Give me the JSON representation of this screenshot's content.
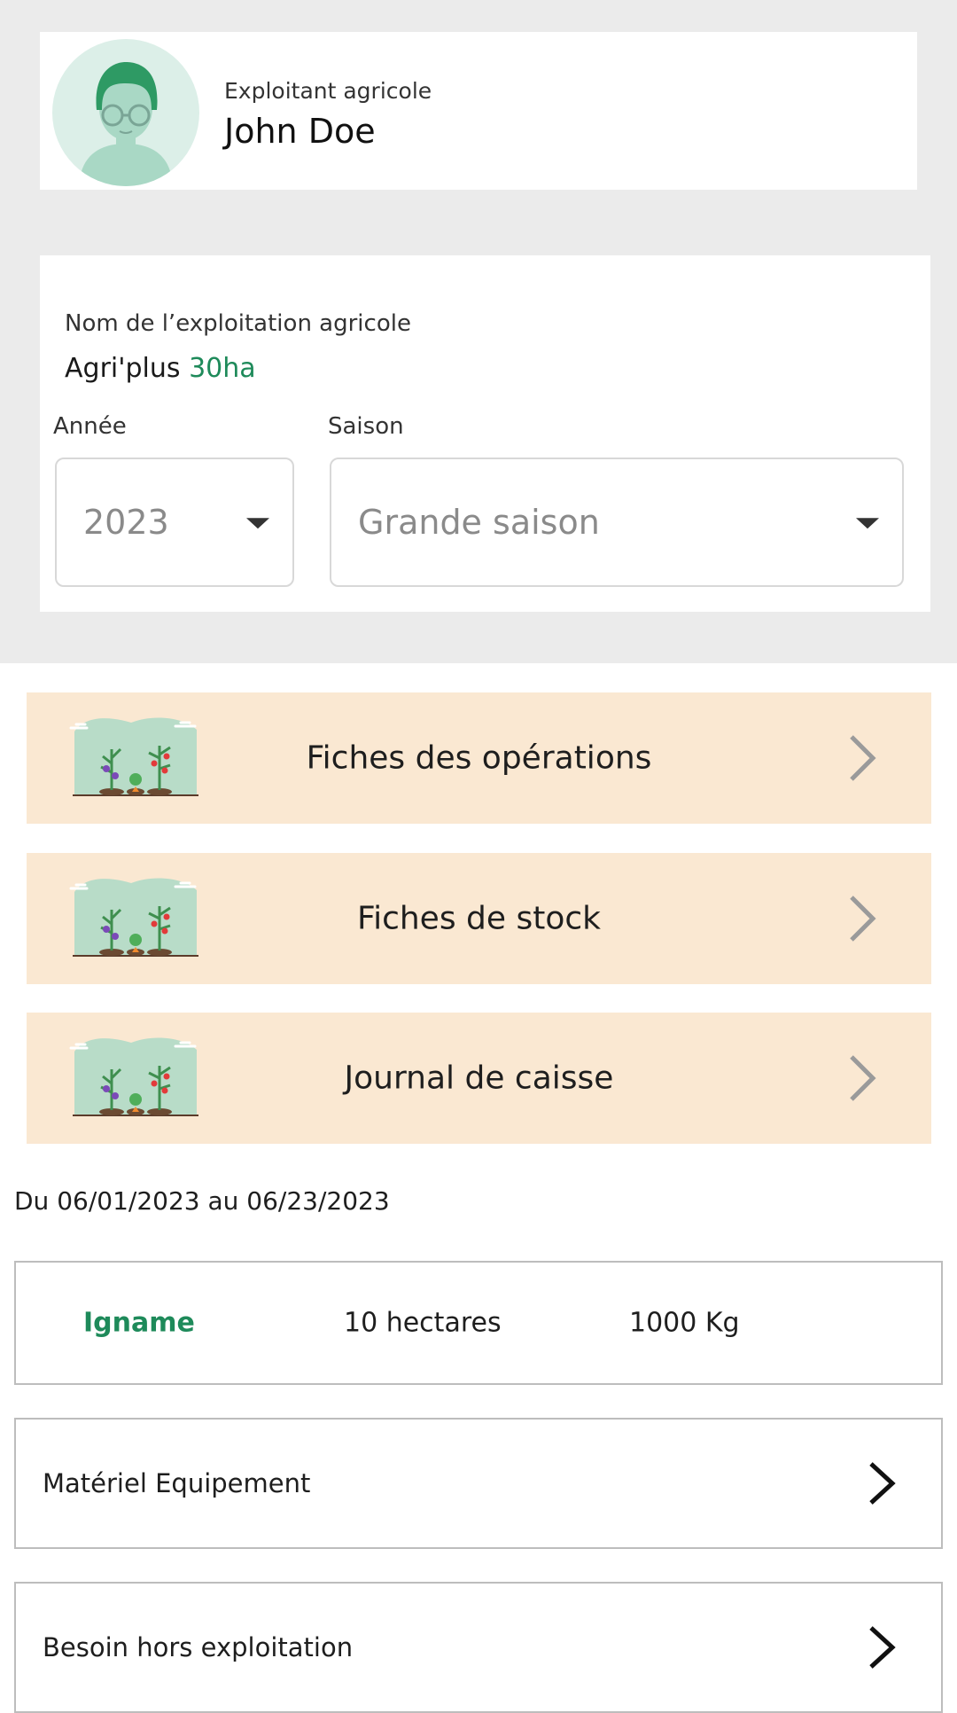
{
  "profile": {
    "role": "Exploitant agricole",
    "name": "John Doe"
  },
  "farm": {
    "label": "Nom de l’exploitation agricole",
    "name": "Agri'plus",
    "area": "30ha",
    "year_label": "Année",
    "year_value": "2023",
    "season_label": "Saison",
    "season_value": "Grande saison"
  },
  "menu": [
    {
      "label": "Fiches des opérations"
    },
    {
      "label": "Fiches de stock"
    },
    {
      "label": "Journal de caisse"
    }
  ],
  "period": "Du 06/01/2023 au 06/23/2023",
  "crop": {
    "name": "Igname",
    "area": "10 hectares",
    "quantity": "1000 Kg"
  },
  "sections": [
    {
      "label": "Matériel Equipement"
    },
    {
      "label": "Besoin hors exploitation"
    }
  ],
  "colors": {
    "accent_green": "#1e8a5a",
    "menu_bg": "#fae8d2",
    "header_bg": "#ebebeb"
  },
  "icons": {
    "avatar": "user-avatar-icon",
    "dropdown": "caret-down-icon",
    "chevron": "chevron-right-icon",
    "illustration": "vegetable-garden-illustration"
  }
}
